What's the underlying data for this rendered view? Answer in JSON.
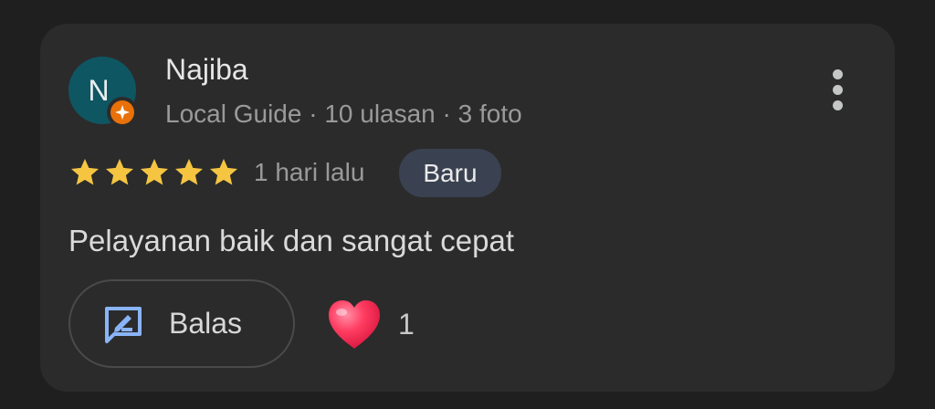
{
  "review": {
    "avatar_initial": "N",
    "reviewer_name": "Najiba",
    "meta": "Local Guide · 10 ulasan · 3 foto",
    "rating": 5,
    "max_rating": 5,
    "time_ago": "1 hari lalu",
    "badge": "Baru",
    "text": "Pelayanan baik dan sangat cepat"
  },
  "actions": {
    "reply_label": "Balas",
    "like_count": "1",
    "more_icon": "more-vertical-icon",
    "reply_icon": "reply-message-icon",
    "like_icon": "heart-icon"
  },
  "colors": {
    "background": "#1f1f1f",
    "card": "#2b2b2b",
    "avatar": "#0f5663",
    "local_guide_badge": "#e8710a",
    "star": "#f5c542",
    "new_badge": "#3a4150",
    "reply_icon": "#8ab4f8",
    "heart": "#ff2d55"
  }
}
